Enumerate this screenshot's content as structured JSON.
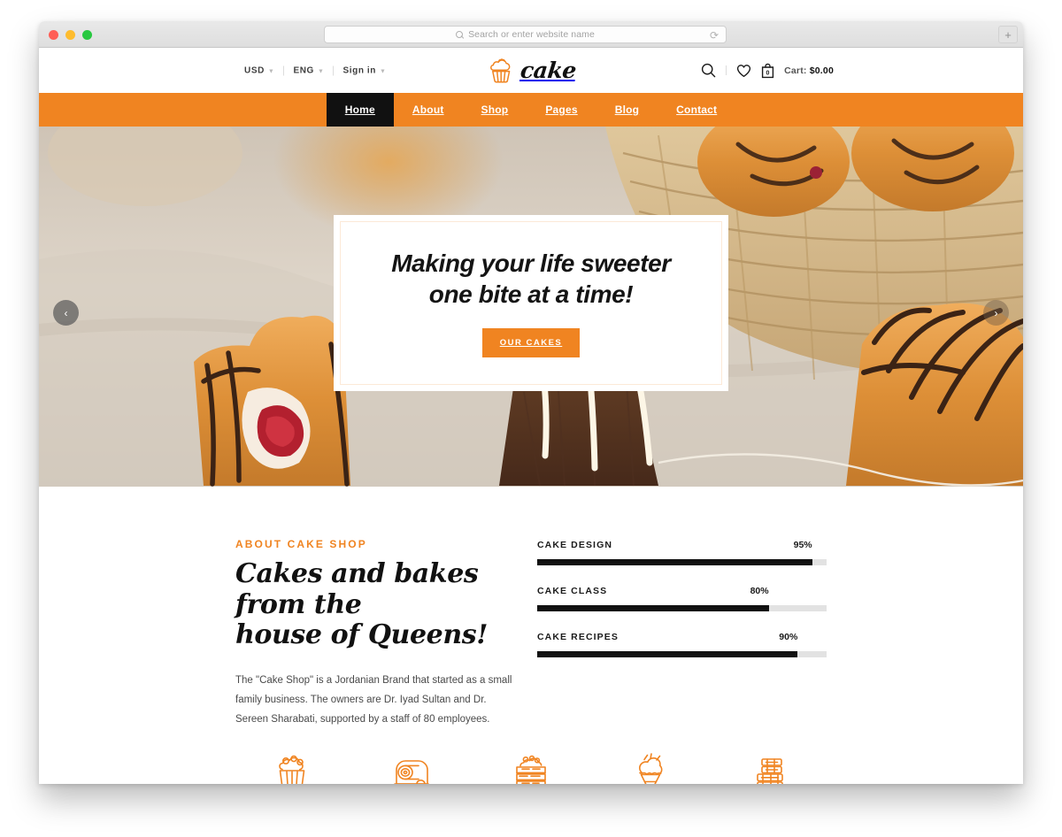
{
  "browser": {
    "url_placeholder": "Search or enter website name",
    "url_value": "",
    "reload_icon": "reload-icon",
    "newtab_label": "+",
    "traffic_lights": [
      "close",
      "minimize",
      "maximize"
    ]
  },
  "topbar": {
    "currency": "USD",
    "language": "ENG",
    "signin": "Sign in",
    "cart_prefix": "Cart: ",
    "cart_total": "$0.00",
    "cart_count": "0",
    "logo_word": "cake",
    "icons": [
      "search-icon",
      "wishlist-heart-icon",
      "shopping-bag-icon"
    ]
  },
  "nav": {
    "items": [
      {
        "label": "Home",
        "active": true
      },
      {
        "label": "About",
        "active": false
      },
      {
        "label": "Shop",
        "active": false
      },
      {
        "label": "Pages",
        "active": false
      },
      {
        "label": "Blog",
        "active": false
      },
      {
        "label": "Contact",
        "active": false
      }
    ],
    "bg_color": "#F08421",
    "active_bg": "#111111"
  },
  "hero": {
    "title_line1": "Making your life sweeter",
    "title_line2": "one bite at a time!",
    "cta_label": "OUR CAKES",
    "prev_arrow": "‹",
    "next_arrow": "›",
    "accent_color": "#F08421"
  },
  "about": {
    "eyebrow": "ABOUT CAKE SHOP",
    "heading_line1": "Cakes and bakes from the",
    "heading_line2": "house of Queens!",
    "body": "The \"Cake Shop\" is a Jordanian Brand that started as a small family business. The owners are Dr. Iyad Sultan and Dr. Sereen Sharabati, supported by a staff of 80 employees.",
    "skills": [
      {
        "name": "CAKE DESIGN",
        "percent": 95,
        "percent_label": "95%"
      },
      {
        "name": "CAKE CLASS",
        "percent": 80,
        "percent_label": "80%"
      },
      {
        "name": "CAKE RECIPES",
        "percent": 90,
        "percent_label": "90%"
      }
    ]
  },
  "icon_strip": {
    "items": [
      {
        "name": "cupcake-icon"
      },
      {
        "name": "swiss-roll-icon"
      },
      {
        "name": "layer-cake-icon"
      },
      {
        "name": "ice-cream-cone-icon"
      },
      {
        "name": "stacked-cake-icon"
      }
    ],
    "color": "#F08421"
  }
}
